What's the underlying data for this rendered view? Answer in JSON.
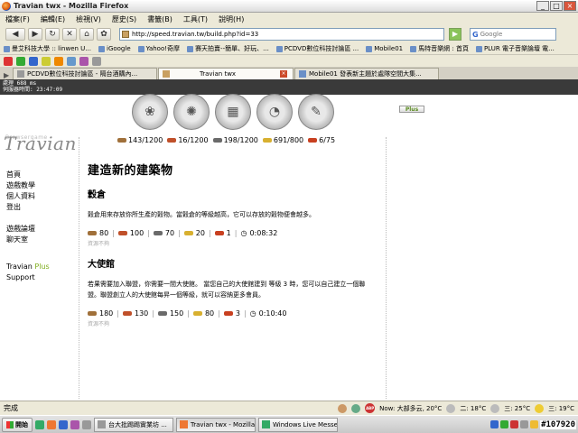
{
  "window": {
    "title": "Travian twx - Mozilla Firefox",
    "buttons": [
      "_",
      "□",
      "×"
    ]
  },
  "menu": [
    "檔案(F)",
    "編輯(E)",
    "檢視(V)",
    "歷史(S)",
    "書籤(B)",
    "工具(T)",
    "說明(H)"
  ],
  "nav": {
    "url": "http://speed.travian.tw/build.php?id=33",
    "search_placeholder": "Google"
  },
  "bookmarks": [
    "曼艾科技大學 :: linwen U...",
    "iGoogle",
    "Yahoo!奇摩",
    "賽天拍賣--簡單、好玩、...",
    "PCDVD數位科技討論區 ...",
    "Mobile01",
    "馬特音樂網 : 首頁",
    "PLUR 電子音樂論壇 電..."
  ],
  "tabs": [
    {
      "label": "PCDVD數位科技討論區 - 隔台酒購內..."
    },
    {
      "label": "Travian twx"
    },
    {
      "label": "Mobile01 發表新主題於處隊空間大集..."
    }
  ],
  "debug": {
    "line1": "處理 688 ms",
    "line2": "伺服器時間: 23:47:09"
  },
  "plus_button": "Plus",
  "logo": {
    "main": "Travian",
    "sub": "Browsergame"
  },
  "resources": [
    {
      "name": "lumber",
      "value": "143/1200",
      "color": "#a0703a"
    },
    {
      "name": "clay",
      "value": "16/1200",
      "color": "#c0502a"
    },
    {
      "name": "iron",
      "value": "198/1200",
      "color": "#6a6a6a"
    },
    {
      "name": "crop",
      "value": "691/800",
      "color": "#d8b030"
    },
    {
      "name": "consumption",
      "value": "6/75",
      "color": "#c84020"
    }
  ],
  "leftnav": {
    "group1": [
      "首頁",
      "遊戲教學",
      "個人資料",
      "登出"
    ],
    "group2": [
      "遊戲論壇",
      "聊天室"
    ],
    "travian_word": "Travian",
    "plus_word": "Plus",
    "support": "Support"
  },
  "content": {
    "title": "建造新的建築物",
    "buildings": [
      {
        "name": "穀倉",
        "desc": "穀倉用來存放你所生產的穀物。當穀倉的等級越高，它可以存放的穀物便會越多。",
        "costs": {
          "lumber": "80",
          "clay": "100",
          "iron": "70",
          "crop": "20",
          "consumption": "1",
          "time": "0:08:32"
        },
        "note": "資源不夠"
      },
      {
        "name": "大使館",
        "desc": "若果需要加入聯盟，你需要一間大使館。 當您自己的大使館建到 等級 3 時，您可以自己建立一個聯盟。聯盟創立人的大使館每昇一個等級，就可以容納更多會員。",
        "costs": {
          "lumber": "180",
          "clay": "130",
          "iron": "150",
          "crop": "80",
          "consumption": "3",
          "time": "0:10:40"
        },
        "note": "資源不夠"
      }
    ]
  },
  "status": {
    "left": "完成",
    "weather_now": "Now: 大部多云, 20°C",
    "w1": "二: 18°C",
    "w2": "三: 25°C",
    "w3": "三: 19°C"
  },
  "taskbar": {
    "start": "開始",
    "tasks": [
      "台大批踢踢實業坊 ...",
      "Travian twx - Mozilla ...",
      "Windows Live Messen..."
    ],
    "watermark": "#107920"
  }
}
